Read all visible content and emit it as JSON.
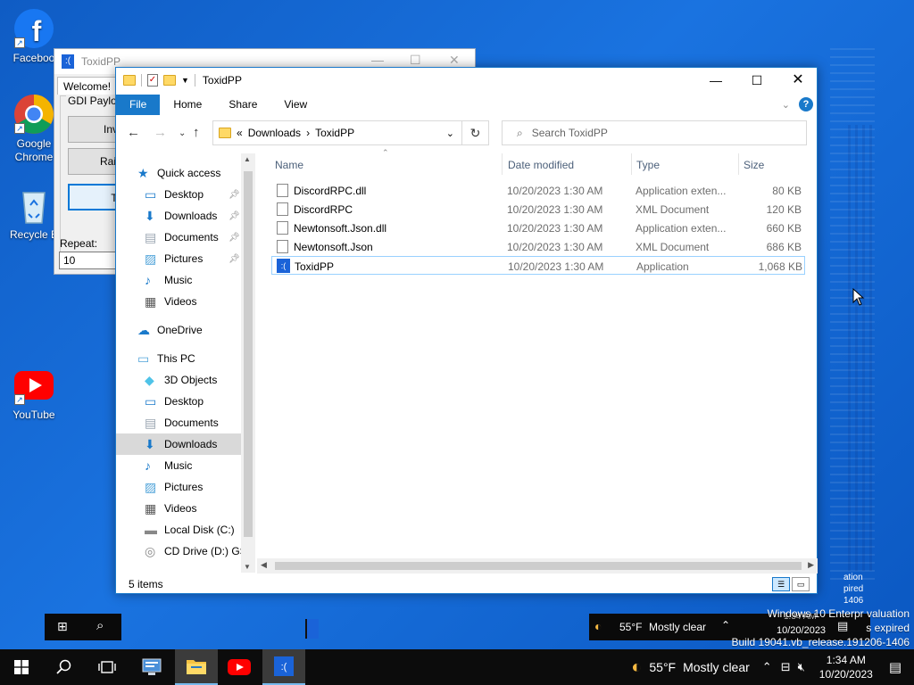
{
  "desktop": {
    "icons": [
      {
        "label": "Faceboo",
        "icon": "facebook-icon"
      },
      {
        "label": "Google Chrome",
        "icon": "chrome-icon"
      },
      {
        "label": "Recycle B",
        "icon": "recycle-bin-icon"
      },
      {
        "label": "YouTube",
        "icon": "youtube-icon"
      }
    ],
    "watermark": {
      "line1": "Windows 10 Enterpr",
      "line1b": "valuation",
      "line2": "s expired",
      "line3": "Build 19041.vb_release.191206-1406",
      "side1": "ation",
      "side2": "pired",
      "side3": "1406"
    }
  },
  "bgwindow": {
    "title": "ToxidPP",
    "tab": "Welcome!",
    "group_label": "GDI Payloa",
    "buttons": [
      "Invert",
      "Rainbo",
      "Tu"
    ],
    "repeat_label": "Repeat:",
    "repeat_value": "10"
  },
  "explorer": {
    "title": "ToxidPP",
    "ribbon_tabs": [
      "File",
      "Home",
      "Share",
      "View"
    ],
    "address": {
      "prefix": "«",
      "crumbs": [
        "Downloads",
        "ToxidPP"
      ]
    },
    "search_placeholder": "Search ToxidPP",
    "nav": [
      {
        "label": "Quick access",
        "icon": "star-icon"
      },
      {
        "label": "Desktop",
        "icon": "desktop-icon",
        "pinned": true
      },
      {
        "label": "Downloads",
        "icon": "download-arrow-icon",
        "pinned": true
      },
      {
        "label": "Documents",
        "icon": "document-icon",
        "pinned": true
      },
      {
        "label": "Pictures",
        "icon": "picture-icon",
        "pinned": true
      },
      {
        "label": "Music",
        "icon": "music-note-icon"
      },
      {
        "label": "Videos",
        "icon": "film-icon"
      },
      {
        "label": "OneDrive",
        "icon": "cloud-icon"
      },
      {
        "label": "This PC",
        "icon": "computer-icon"
      },
      {
        "label": "3D Objects",
        "icon": "cube-icon"
      },
      {
        "label": "Desktop",
        "icon": "desktop-icon"
      },
      {
        "label": "Documents",
        "icon": "document-icon"
      },
      {
        "label": "Downloads",
        "icon": "download-arrow-icon",
        "active": true
      },
      {
        "label": "Music",
        "icon": "music-note-icon"
      },
      {
        "label": "Pictures",
        "icon": "picture-icon"
      },
      {
        "label": "Videos",
        "icon": "film-icon"
      },
      {
        "label": "Local Disk (C:)",
        "icon": "disk-icon"
      },
      {
        "label": "CD Drive (D:) GS",
        "icon": "cd-drive-icon"
      }
    ],
    "columns": [
      "Name",
      "Date modified",
      "Type",
      "Size"
    ],
    "files": [
      {
        "name": "DiscordRPC.dll",
        "date": "10/20/2023 1:30 AM",
        "type": "Application exten...",
        "size": "80 KB"
      },
      {
        "name": "DiscordRPC",
        "date": "10/20/2023 1:30 AM",
        "type": "XML Document",
        "size": "120 KB"
      },
      {
        "name": "Newtonsoft.Json.dll",
        "date": "10/20/2023 1:30 AM",
        "type": "Application exten...",
        "size": "660 KB"
      },
      {
        "name": "Newtonsoft.Json",
        "date": "10/20/2023 1:30 AM",
        "type": "XML Document",
        "size": "686 KB"
      },
      {
        "name": "ToxidPP",
        "date": "10/20/2023 1:30 AM",
        "type": "Application",
        "size": "1,068 KB",
        "selected": true
      }
    ],
    "status": "5 items"
  },
  "ghost_tray": {
    "weather": "55°F",
    "condition": "Mostly clear",
    "time": "1:34 AM",
    "date": "10/20/2023"
  },
  "taskbar": {
    "weather_temp": "55°F",
    "weather_text": "Mostly clear",
    "time": "1:34 AM",
    "date": "10/20/2023"
  }
}
